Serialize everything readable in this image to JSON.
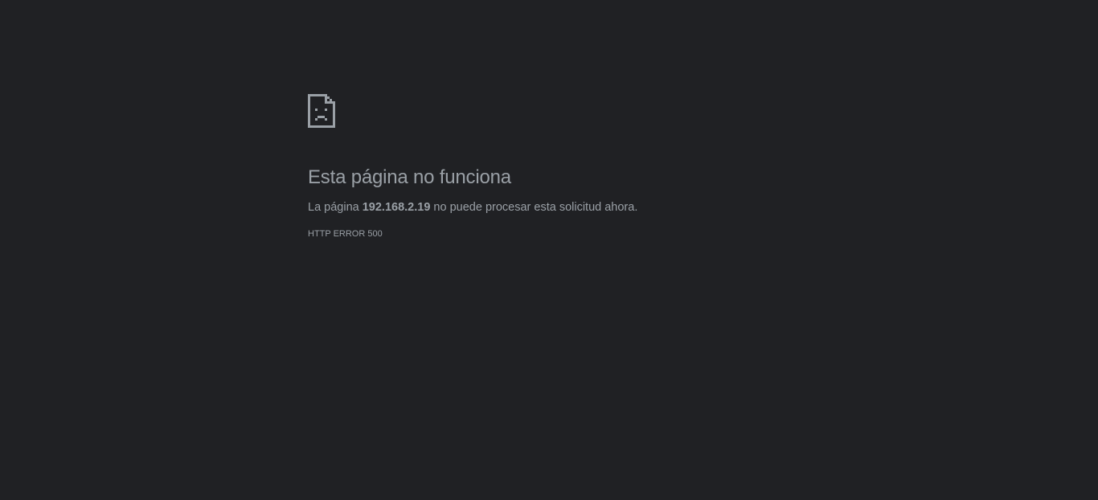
{
  "error_page": {
    "icon": "sad-page-icon",
    "title": "Esta página no funciona",
    "message": {
      "prefix": "La página ",
      "host": "192.168.2.19",
      "suffix": " no puede procesar esta solicitud ahora."
    },
    "error_code": "HTTP ERROR 500"
  },
  "colors": {
    "background": "#202124",
    "text": "#9aa0a6"
  }
}
